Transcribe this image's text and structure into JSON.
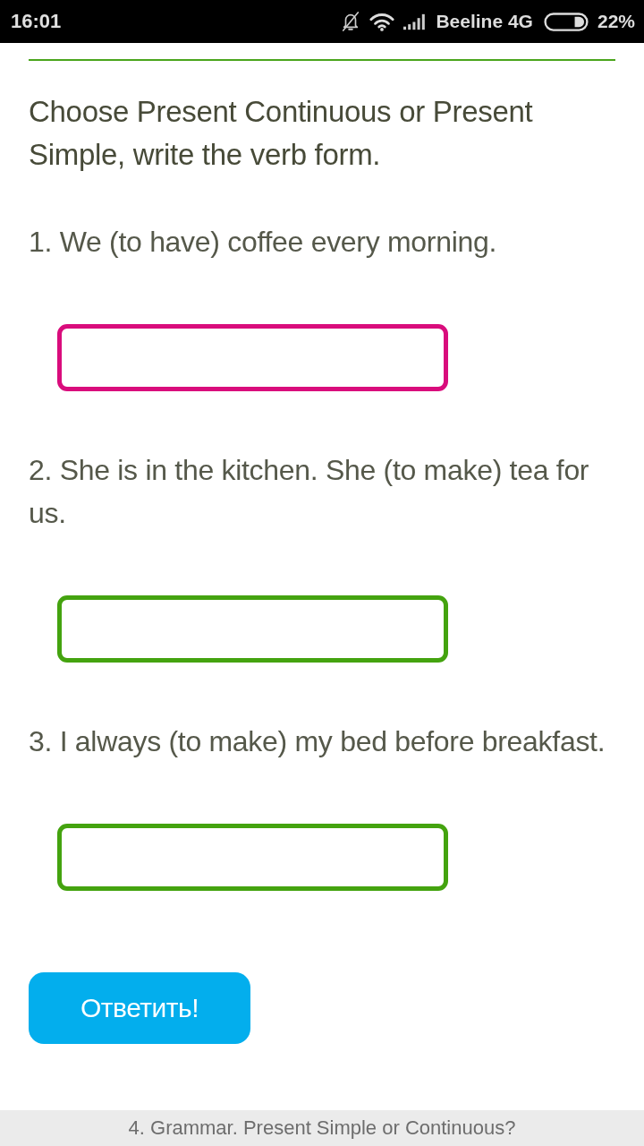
{
  "status_bar": {
    "time": "16:01",
    "carrier": "Beeline 4G",
    "battery": "22%"
  },
  "instruction": "Choose Present Continuous or Present Simple, write the verb form.",
  "questions": [
    {
      "text": "1. We (to have) coffee every morning.",
      "focused": true
    },
    {
      "text": "2. She is in the kitchen. She (to make) tea for us.",
      "focused": false
    },
    {
      "text": "3. I always (to make) my bed before breakfast.",
      "focused": false
    }
  ],
  "submit_button": "Ответить!",
  "footer": "4. Grammar. Present Simple or Continuous?"
}
